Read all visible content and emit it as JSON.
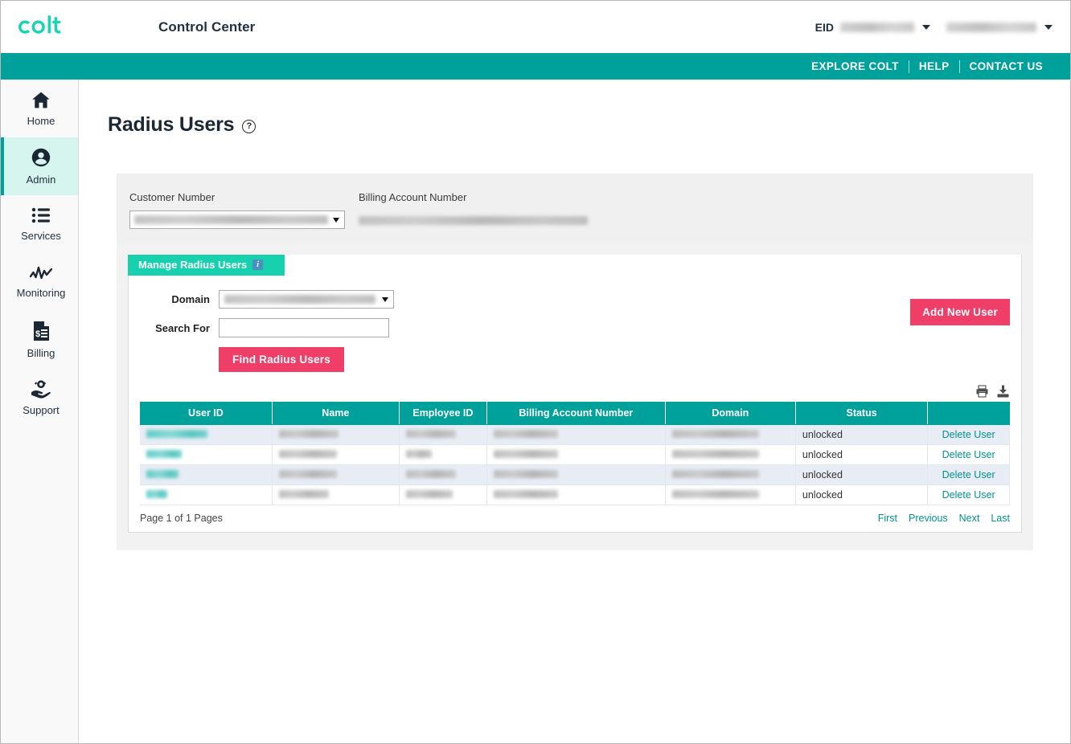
{
  "header": {
    "logo_text": "colt",
    "app_title": "Control Center",
    "eid_label": "EID",
    "eid_value": "",
    "user_value": ""
  },
  "nav_links": [
    {
      "label": "EXPLORE COLT"
    },
    {
      "label": "HELP"
    },
    {
      "label": "CONTACT US"
    }
  ],
  "sidebar": {
    "items": [
      {
        "label": "Home",
        "icon": "home-icon",
        "active": false
      },
      {
        "label": "Admin",
        "icon": "user-circle-icon",
        "active": true
      },
      {
        "label": "Services",
        "icon": "list-icon",
        "active": false
      },
      {
        "label": "Monitoring",
        "icon": "activity-icon",
        "active": false
      },
      {
        "label": "Billing",
        "icon": "invoice-icon",
        "active": false
      },
      {
        "label": "Support",
        "icon": "support-icon",
        "active": false
      }
    ]
  },
  "page": {
    "title": "Radius Users",
    "help_icon": "question-circle-icon"
  },
  "account_panel": {
    "customer_number_label": "Customer Number",
    "customer_number_value": "",
    "billing_account_number_label": "Billing Account Number",
    "billing_account_number_value": ""
  },
  "panel": {
    "tab_label": "Manage Radius Users",
    "tab_info_icon": "info-icon",
    "domain_label": "Domain",
    "domain_value": "",
    "search_label": "Search For",
    "search_value": "",
    "search_placeholder": "",
    "find_button": "Find Radius Users",
    "add_user_button": "Add New User",
    "print_icon": "print-icon",
    "download_icon": "download-icon"
  },
  "table": {
    "columns": [
      "User ID",
      "Name",
      "Employee ID",
      "Billing Account Number",
      "Domain",
      "Status",
      ""
    ],
    "rows": [
      {
        "user_id": "",
        "name": "",
        "employee_id": "",
        "billing_account_number": "",
        "domain": "",
        "status": "unlocked",
        "action": "Delete User"
      },
      {
        "user_id": "",
        "name": "",
        "employee_id": "",
        "billing_account_number": "",
        "domain": "",
        "status": "unlocked",
        "action": "Delete User"
      },
      {
        "user_id": "",
        "name": "",
        "employee_id": "",
        "billing_account_number": "",
        "domain": "",
        "status": "unlocked",
        "action": "Delete User"
      },
      {
        "user_id": "",
        "name": "",
        "employee_id": "",
        "billing_account_number": "",
        "domain": "",
        "status": "unlocked",
        "action": "Delete User"
      }
    ]
  },
  "pagination": {
    "page_text": "Page 1 of 1 Pages",
    "first": "First",
    "previous": "Previous",
    "next": "Next",
    "last": "Last"
  },
  "colors": {
    "teal": "#00A19B",
    "tab_teal": "#17D0AE",
    "pink": "#EF3E68",
    "active_nav_bg": "#D6F5EE",
    "link_teal": "#00938F",
    "row_alt": "#E8EDF5"
  }
}
